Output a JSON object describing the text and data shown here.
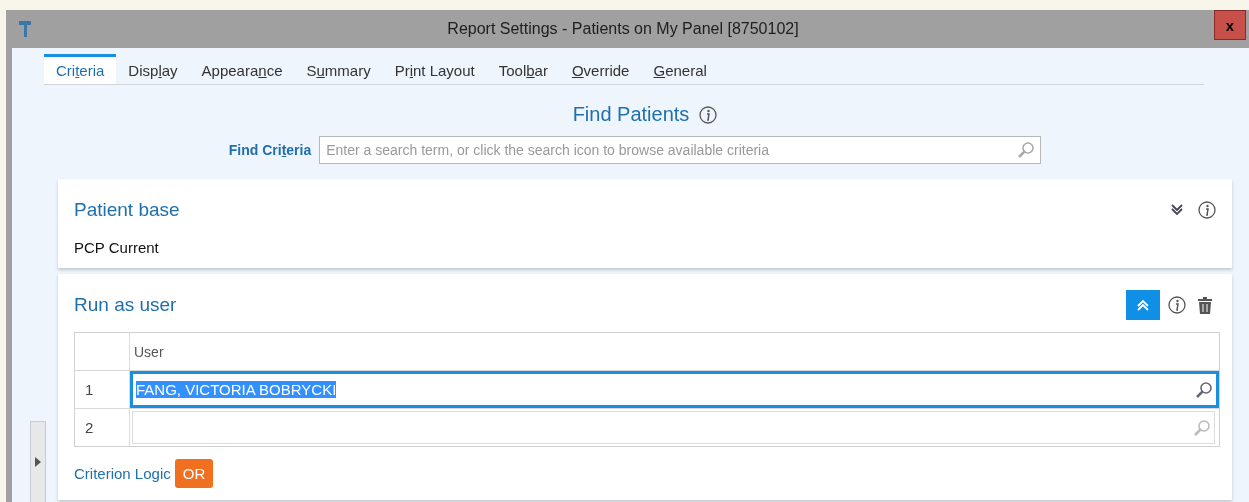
{
  "window": {
    "title": "Report Settings - Patients on My Panel [8750102]",
    "close": "x"
  },
  "tabs": [
    {
      "pre": "Cri",
      "key": "t",
      "post": "eria",
      "selected": true
    },
    {
      "pre": "Disp",
      "key": "l",
      "post": "ay",
      "selected": false
    },
    {
      "pre": "Appeara",
      "key": "n",
      "post": "ce",
      "selected": false
    },
    {
      "pre": "S",
      "key": "u",
      "post": "mmary",
      "selected": false
    },
    {
      "pre": "Pr",
      "key": "i",
      "post": "nt Layout",
      "selected": false
    },
    {
      "pre": "Tool",
      "key": "b",
      "post": "ar",
      "selected": false
    },
    {
      "key": "O",
      "post": "verride",
      "selected": false
    },
    {
      "key": "G",
      "post": "eneral",
      "selected": false
    }
  ],
  "heading": "Find Patients",
  "find_criteria": {
    "pre": "Find Cri",
    "key": "t",
    "post": "eria",
    "placeholder": "Enter a search term, or click the search icon to browse available criteria"
  },
  "sections": [
    {
      "title": "Patient base",
      "expanded": false,
      "removable": false,
      "value": "PCP Current"
    },
    {
      "title": "Run as user",
      "expanded": true,
      "removable": true,
      "table": {
        "columns": [
          "User"
        ],
        "rows": [
          {
            "number": "1",
            "value": "FANG, VICTORIA BOBRYCKI",
            "focused": true
          },
          {
            "number": "2",
            "focused": false
          }
        ]
      },
      "logic_label": "Criterion Logic",
      "logic_value": "OR"
    }
  ]
}
